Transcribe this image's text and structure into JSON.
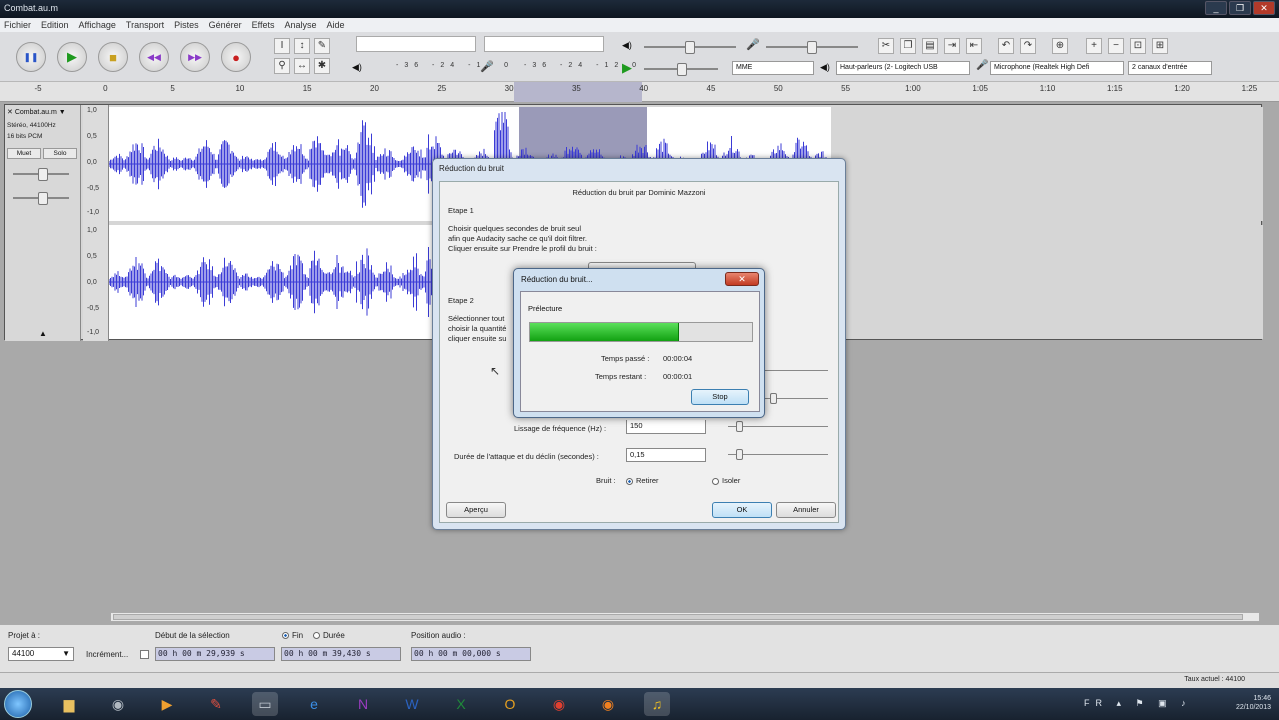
{
  "window": {
    "title": "Combat.au.m",
    "controls": [
      "_",
      "❐",
      "✕"
    ]
  },
  "menu": [
    "Fichier",
    "Edition",
    "Affichage",
    "Transport",
    "Pistes",
    "Générer",
    "Effets",
    "Analyse",
    "Aide"
  ],
  "toolbar": {
    "transport": [
      {
        "name": "pause-button",
        "icon": "pause-icon",
        "glyph": "❚❚",
        "color": "#2a55c8"
      },
      {
        "name": "play-button",
        "icon": "play-icon",
        "glyph": "▶",
        "color": "#1f9a1f"
      },
      {
        "name": "stop-button",
        "icon": "stop-icon",
        "glyph": "■",
        "color": "#c8a020"
      },
      {
        "name": "skip-start-button",
        "icon": "skip-start-icon",
        "glyph": "◀◀",
        "color": "#8a3ac8"
      },
      {
        "name": "skip-end-button",
        "icon": "skip-end-icon",
        "glyph": "▶▶",
        "color": "#8a3ac8"
      },
      {
        "name": "record-button",
        "icon": "record-icon",
        "glyph": "●",
        "color": "#c81f1f"
      }
    ],
    "meter_ticks": "-36 -24 -12 0",
    "host": "MME",
    "output_device": "Haut-parleurs (2- Logitech USB",
    "input_device": "Microphone (Realtek High Defi",
    "channels": "2 canaux d'entrée"
  },
  "ruler": [
    "-5",
    "0",
    "5",
    "10",
    "15",
    "20",
    "25",
    "30",
    "35",
    "40",
    "45",
    "50",
    "55",
    "1:00",
    "1:05",
    "1:10",
    "1:15",
    "1:20",
    "1:25"
  ],
  "track": {
    "name": "Combat.au.m",
    "info1": "Stéréo, 44100Hz",
    "info2": "16 bits PCM",
    "mute": "Muet",
    "solo": "Solo",
    "scale": [
      "1,0",
      "0,5",
      "0,0",
      "-0,5",
      "-1,0"
    ]
  },
  "noise_dialog": {
    "title": "Réduction du bruit",
    "header": "Réduction du bruit par Dominic Mazzoni",
    "step1_title": "Etape 1",
    "step1_lines": [
      "Choisir quelques secondes de bruit seul",
      "afin que Audacity sache ce qu'il doit filtrer.",
      "Cliquer ensuite sur Prendre le profil du bruit :"
    ],
    "step2_title": "Etape 2",
    "step2_lines": [
      "Sélectionner tout",
      "choisir la quantité",
      "cliquer ensuite su"
    ],
    "freq_label": "Lissage de fréquence (Hz) :",
    "freq_value": "150",
    "attack_label": "Durée de l'attaque et du déclin (secondes) :",
    "attack_value": "0,15",
    "noise_label": "Bruit :",
    "remove_label": "Retirer",
    "isolate_label": "Isoler",
    "preview": "Aperçu",
    "ok": "OK",
    "cancel": "Annuler"
  },
  "progress_dialog": {
    "title": "Réduction du bruit...",
    "stage": "Prélecture",
    "progress": 0.67,
    "elapsed_label": "Temps passé :",
    "elapsed": "00:00:04",
    "remaining_label": "Temps restant :",
    "remaining": "00:00:01",
    "stop": "Stop"
  },
  "selection_bar": {
    "project_rate_label": "Projet à :",
    "project_rate": "44100",
    "snap_label": "Incrément...",
    "sel_start_label": "Début de la sélection",
    "end_label": "Fin",
    "length_label": "Durée",
    "sel_start": "00 h 00 m 29,939 s",
    "sel_end": "00 h 00 m 39,430 s",
    "audio_pos_label": "Position audio :",
    "audio_pos": "00 h 00 m 00,000 s"
  },
  "status": "Taux actuel : 44100",
  "taskbar": {
    "apps": [
      {
        "name": "explorer-icon",
        "glyph": "▆",
        "color": "#e8c060"
      },
      {
        "name": "media-center-icon",
        "glyph": "◉",
        "color": "#b0b8c0"
      },
      {
        "name": "media-player-icon",
        "glyph": "▶",
        "color": "#f0a030"
      },
      {
        "name": "paint-icon",
        "glyph": "✎",
        "color": "#e05040"
      },
      {
        "name": "window-icon",
        "glyph": "▭",
        "color": "#c0c8d0"
      },
      {
        "name": "ie-icon",
        "glyph": "e",
        "color": "#3a8ee6"
      },
      {
        "name": "onenote-icon",
        "glyph": "N",
        "color": "#9a3cc0"
      },
      {
        "name": "word-icon",
        "glyph": "W",
        "color": "#2b62c0"
      },
      {
        "name": "excel-icon",
        "glyph": "X",
        "color": "#1f8a3a"
      },
      {
        "name": "outlook-icon",
        "glyph": "O",
        "color": "#e6a020"
      },
      {
        "name": "chrome-icon",
        "glyph": "◉",
        "color": "#e04030"
      },
      {
        "name": "firefox-icon",
        "glyph": "◉",
        "color": "#f08020"
      },
      {
        "name": "audacity-icon",
        "glyph": "♫",
        "color": "#f0c020"
      }
    ],
    "lang": "FR",
    "time": "15:46",
    "date": "22/10/2013"
  }
}
